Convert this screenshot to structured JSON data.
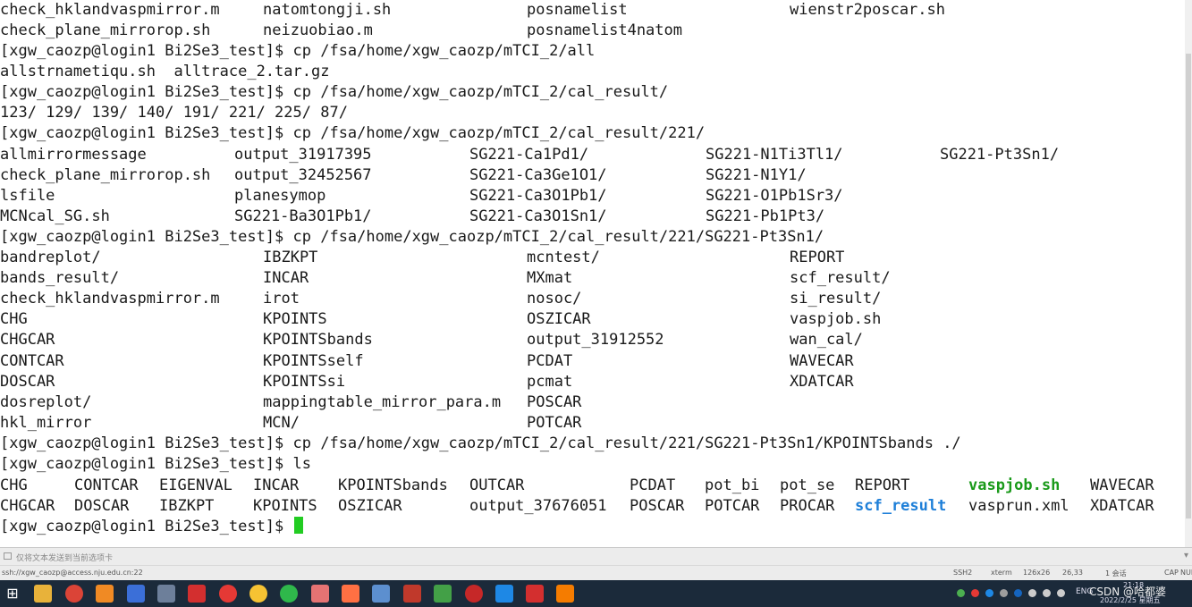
{
  "terminal": {
    "lines": [
      {
        "cells": [
          {
            "t": "check_hklandvaspmirror.m"
          },
          {
            "t": "natomtongji.sh"
          },
          {
            "t": "posnamelist"
          },
          {
            "t": "wienstr2poscar.sh"
          }
        ]
      },
      {
        "cells": [
          {
            "t": "check_plane_mirrorop.sh"
          },
          {
            "t": "neizuobiao.m"
          },
          {
            "t": "posnamelist4natom"
          }
        ]
      },
      {
        "cells": [
          {
            "t": "[xgw_caozp@login1 Bi2Se3_test]$ cp /fsa/home/xgw_caozp/mTCI_2/all"
          }
        ]
      },
      {
        "cells": [
          {
            "t": "allstrnametiqu.sh  alltrace_2.tar.gz"
          }
        ]
      },
      {
        "cells": [
          {
            "t": "[xgw_caozp@login1 Bi2Se3_test]$ cp /fsa/home/xgw_caozp/mTCI_2/cal_result/"
          }
        ]
      },
      {
        "cells": [
          {
            "t": "123/ 129/ 139/ 140/ 191/ 221/ 225/ 87/"
          }
        ]
      },
      {
        "cells": [
          {
            "t": "[xgw_caozp@login1 Bi2Se3_test]$ cp /fsa/home/xgw_caozp/mTCI_2/cal_result/221/"
          }
        ]
      },
      {
        "cells": [
          {
            "t": "allmirrormessage"
          },
          {
            "t": "output_31917395"
          },
          {
            "t": "SG221-Ca1Pd1/"
          },
          {
            "t": "SG221-N1Ti3Tl1/"
          },
          {
            "t": "SG221-Pt3Sn1/"
          }
        ]
      },
      {
        "cells": [
          {
            "t": "check_plane_mirrorop.sh"
          },
          {
            "t": "output_32452567"
          },
          {
            "t": "SG221-Ca3Ge1O1/"
          },
          {
            "t": "SG221-N1Y1/"
          }
        ]
      },
      {
        "cells": [
          {
            "t": "lsfile"
          },
          {
            "t": "planesymop"
          },
          {
            "t": "SG221-Ca3O1Pb1/"
          },
          {
            "t": "SG221-O1Pb1Sr3/"
          }
        ]
      },
      {
        "cells": [
          {
            "t": "MCNcal_SG.sh"
          },
          {
            "t": "SG221-Ba3O1Pb1/"
          },
          {
            "t": "SG221-Ca3O1Sn1/"
          },
          {
            "t": "SG221-Pb1Pt3/"
          }
        ]
      },
      {
        "cells": [
          {
            "t": "[xgw_caozp@login1 Bi2Se3_test]$ cp /fsa/home/xgw_caozp/mTCI_2/cal_result/221/SG221-Pt3Sn1/"
          }
        ]
      },
      {
        "cells": [
          {
            "t": "bandreplot/"
          },
          {
            "t": "IBZKPT"
          },
          {
            "t": "mcntest/"
          },
          {
            "t": "REPORT"
          }
        ]
      },
      {
        "cells": [
          {
            "t": "bands_result/"
          },
          {
            "t": "INCAR"
          },
          {
            "t": "MXmat"
          },
          {
            "t": "scf_result/"
          }
        ]
      },
      {
        "cells": [
          {
            "t": "check_hklandvaspmirror.m"
          },
          {
            "t": "irot"
          },
          {
            "t": "nosoc/"
          },
          {
            "t": "si_result/"
          }
        ]
      },
      {
        "cells": [
          {
            "t": "CHG"
          },
          {
            "t": "KPOINTS"
          },
          {
            "t": "OSZICAR"
          },
          {
            "t": "vaspjob.sh"
          }
        ]
      },
      {
        "cells": [
          {
            "t": "CHGCAR"
          },
          {
            "t": "KPOINTSbands"
          },
          {
            "t": "output_31912552"
          },
          {
            "t": "wan_cal/"
          }
        ]
      },
      {
        "cells": [
          {
            "t": "CONTCAR"
          },
          {
            "t": "KPOINTSself"
          },
          {
            "t": "PCDAT"
          },
          {
            "t": "WAVECAR"
          }
        ]
      },
      {
        "cells": [
          {
            "t": "DOSCAR"
          },
          {
            "t": "KPOINTSsi"
          },
          {
            "t": "pcmat"
          },
          {
            "t": "XDATCAR"
          }
        ]
      },
      {
        "cells": [
          {
            "t": "dosreplot/"
          },
          {
            "t": "mappingtable_mirror_para.m"
          },
          {
            "t": "POSCAR"
          }
        ]
      },
      {
        "cells": [
          {
            "t": "hkl_mirror"
          },
          {
            "t": "MCN/"
          },
          {
            "t": "POTCAR"
          }
        ]
      },
      {
        "cells": [
          {
            "t": "[xgw_caozp@login1 Bi2Se3_test]$ cp /fsa/home/xgw_caozp/mTCI_2/cal_result/221/SG221-Pt3Sn1/KPOINTSbands ./"
          }
        ]
      },
      {
        "cells": [
          {
            "t": "[xgw_caozp@login1 Bi2Se3_test]$ ls"
          }
        ]
      },
      {
        "cells": [
          {
            "t": "CHG"
          },
          {
            "t": "CONTCAR"
          },
          {
            "t": "EIGENVAL"
          },
          {
            "t": "INCAR"
          },
          {
            "t": "KPOINTSbands"
          },
          {
            "t": "OUTCAR"
          },
          {
            "t": "PCDAT"
          },
          {
            "t": "pot_bi"
          },
          {
            "t": "pot_se"
          },
          {
            "t": "REPORT"
          },
          {
            "t": "vaspjob.sh",
            "c": "exec"
          },
          {
            "t": "WAVECAR"
          }
        ]
      },
      {
        "cells": [
          {
            "t": "CHGCAR"
          },
          {
            "t": "DOSCAR"
          },
          {
            "t": "IBZKPT"
          },
          {
            "t": "KPOINTS"
          },
          {
            "t": "OSZICAR"
          },
          {
            "t": "output_37676051"
          },
          {
            "t": "POSCAR"
          },
          {
            "t": "POTCAR"
          },
          {
            "t": "PROCAR"
          },
          {
            "t": "scf_result",
            "c": "dir"
          },
          {
            "t": "vasprun.xml"
          },
          {
            "t": "XDATCAR"
          }
        ]
      },
      {
        "cells": [
          {
            "t": "[xgw_caozp@login1 Bi2Se3_test]$ "
          }
        ],
        "cursor": true
      }
    ]
  },
  "command_bar": {
    "placeholder": "仅将文本发送到当前选项卡"
  },
  "status_bar": {
    "host": "ssh://xgw_caozp@access.nju.edu.cn:22",
    "protocol": "SSH2",
    "term": "xterm",
    "size": "126x26",
    "pos": "26,33",
    "sessions": "1 会话",
    "caps": "CAP",
    "num": "NUM"
  },
  "taskbar": {
    "lang": "ENG",
    "watermark": "CSDN @哈都婆",
    "time": "21:18",
    "date": "2022/2/25 星期五"
  }
}
